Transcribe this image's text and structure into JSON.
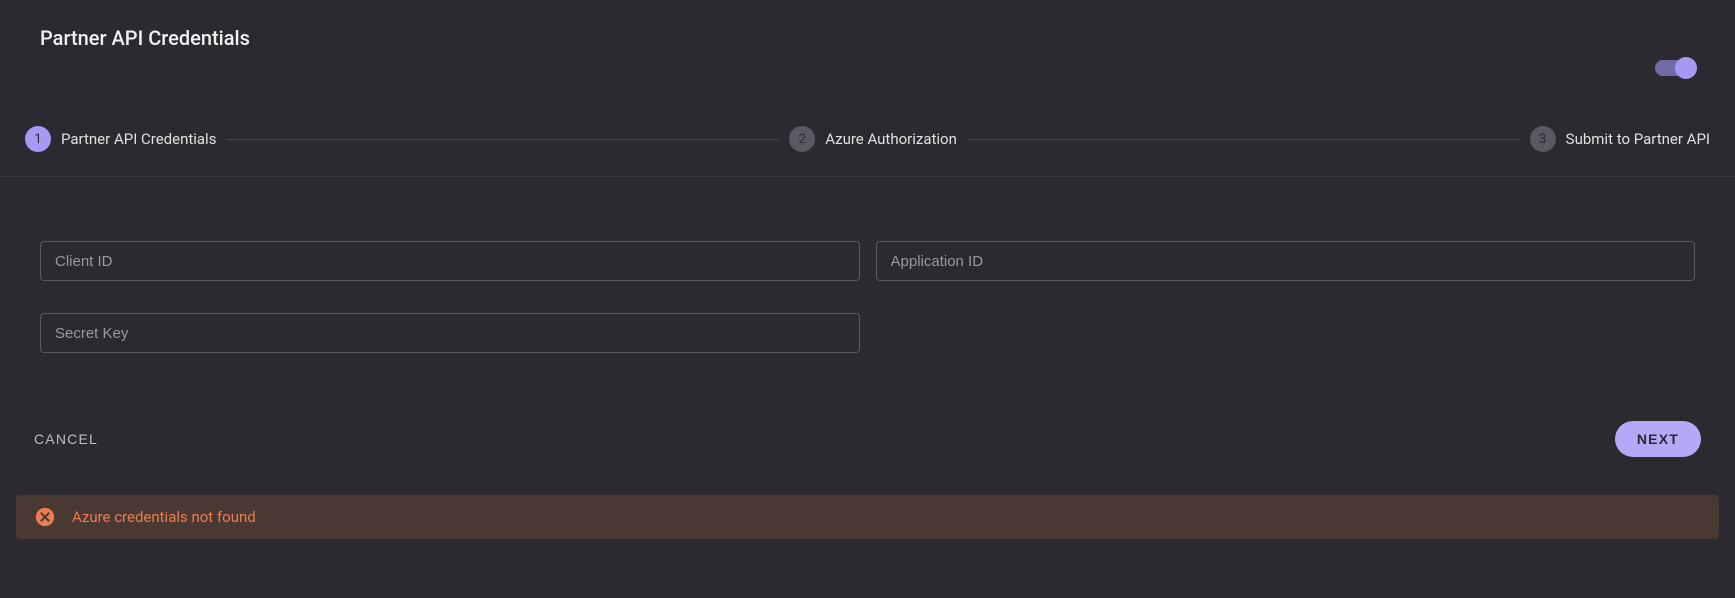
{
  "header": {
    "title": "Partner API Credentials"
  },
  "toggle": {
    "enabled": true
  },
  "stepper": {
    "steps": [
      {
        "number": "1",
        "label": "Partner API Credentials",
        "active": true
      },
      {
        "number": "2",
        "label": "Azure Authorization",
        "active": false
      },
      {
        "number": "3",
        "label": "Submit to Partner API",
        "active": false
      }
    ]
  },
  "form": {
    "client_id": {
      "placeholder": "Client ID",
      "value": ""
    },
    "application_id": {
      "placeholder": "Application ID",
      "value": ""
    },
    "secret_key": {
      "placeholder": "Secret Key",
      "value": ""
    }
  },
  "actions": {
    "cancel_label": "CANCEL",
    "next_label": "NEXT"
  },
  "alert": {
    "message": "Azure credentials not found"
  }
}
